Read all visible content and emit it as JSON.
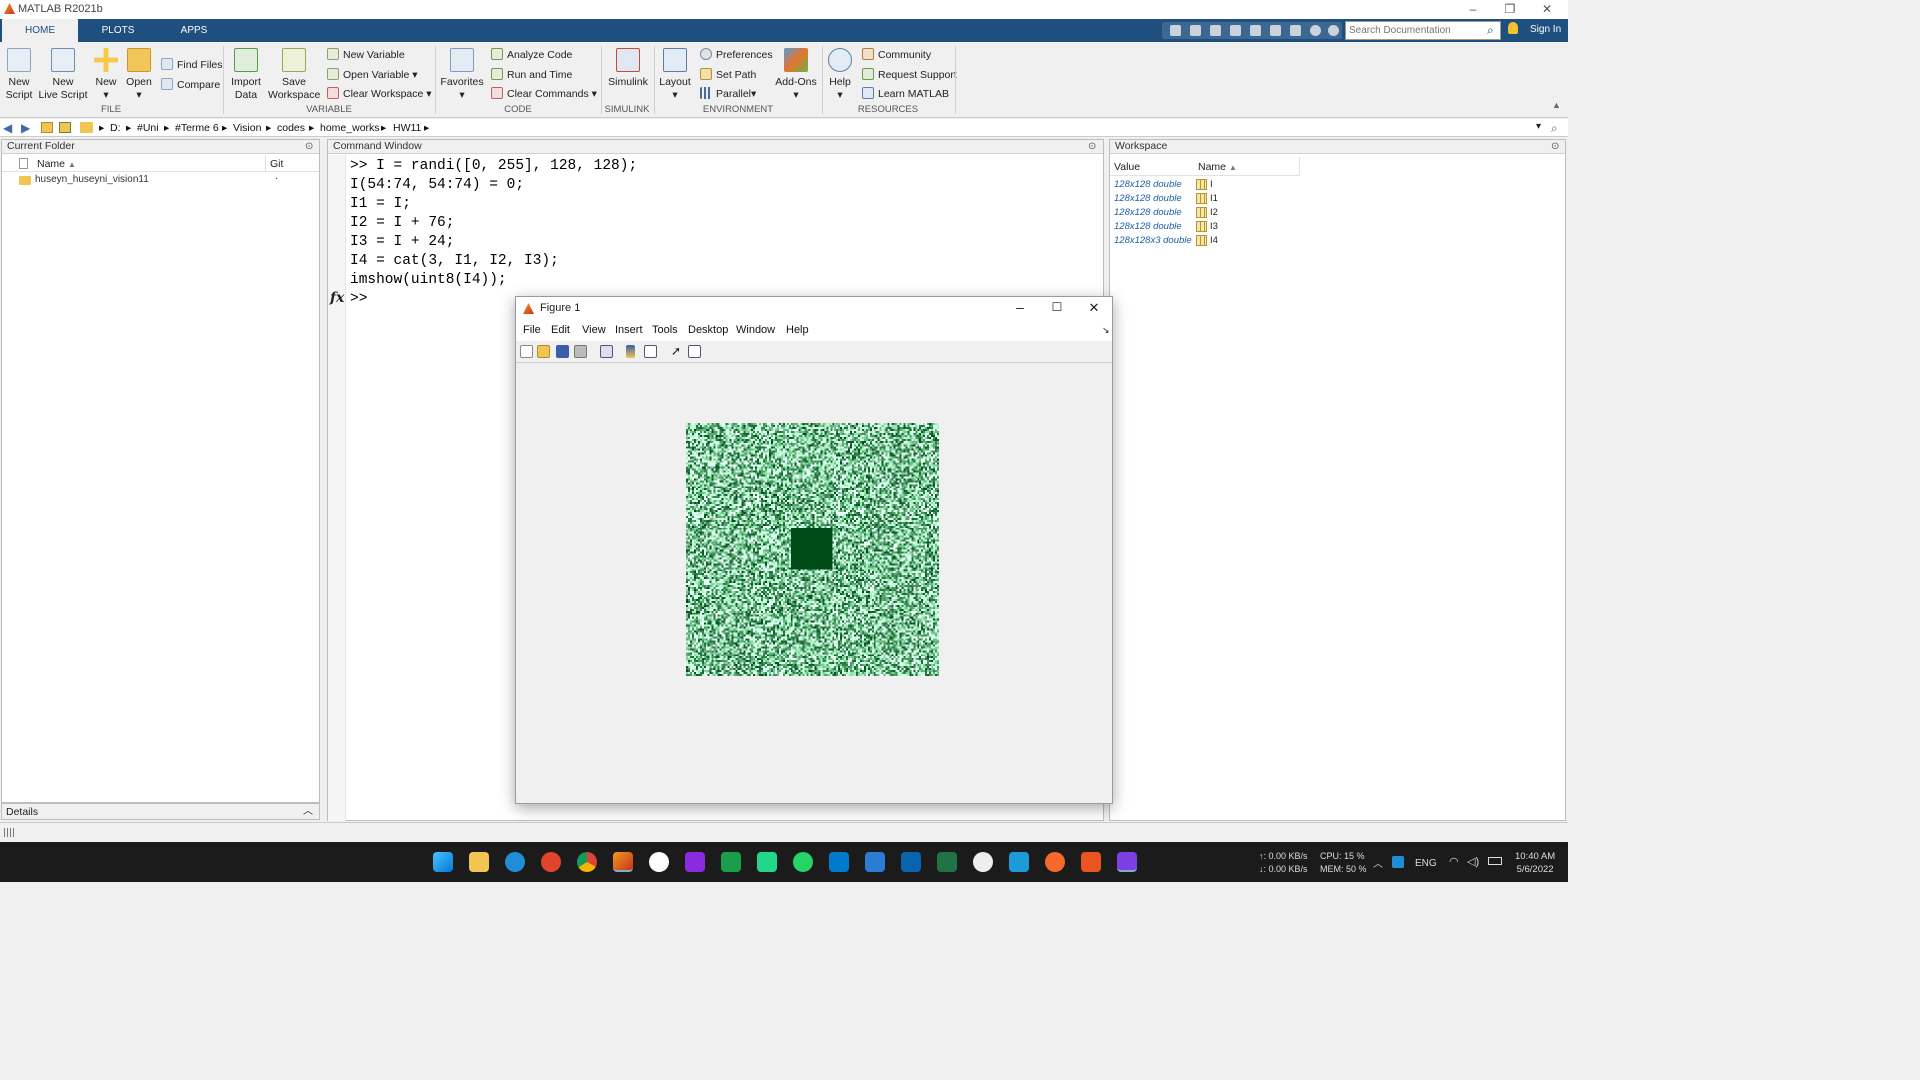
{
  "app": {
    "title": "MATLAB R2021b"
  },
  "tabs": [
    {
      "label": "HOME",
      "active": true
    },
    {
      "label": "PLOTS",
      "active": false
    },
    {
      "label": "APPS",
      "active": false
    }
  ],
  "search": {
    "placeholder": "Search Documentation"
  },
  "signin": "Sign In",
  "ribbon": {
    "file": {
      "new_script": [
        "New",
        "Script"
      ],
      "new_live_script": [
        "New",
        "Live Script"
      ],
      "new": "New",
      "open": "Open",
      "find_files": "Find Files",
      "compare": "Compare",
      "group": "FILE"
    },
    "variable": {
      "import_data": [
        "Import",
        "Data"
      ],
      "save_workspace": [
        "Save",
        "Workspace"
      ],
      "new_variable": "New Variable",
      "open_variable": "Open Variable",
      "clear_workspace": "Clear Workspace",
      "group": "VARIABLE"
    },
    "code": {
      "favorites": "Favorites",
      "analyze_code": "Analyze Code",
      "run_and_time": "Run and Time",
      "clear_commands": "Clear Commands",
      "group": "CODE"
    },
    "simulink": {
      "simulink": "Simulink",
      "group": "SIMULINK"
    },
    "environment": {
      "layout": "Layout",
      "preferences": "Preferences",
      "set_path": "Set Path",
      "parallel": "Parallel",
      "addons": "Add-Ons",
      "group": "ENVIRONMENT"
    },
    "resources": {
      "help": "Help",
      "community": "Community",
      "request_support": "Request Support",
      "learn_matlab": "Learn MATLAB",
      "group": "RESOURCES"
    }
  },
  "path": [
    "D:",
    "#Uni",
    "#Terme 6",
    "Vision",
    "codes",
    "home_works",
    "HW11"
  ],
  "current_folder": {
    "title": "Current Folder",
    "col_name": "Name",
    "col_git": "Git",
    "items": [
      {
        "name": "huseyn_huseyni_vision11",
        "git": "·"
      }
    ],
    "details": "Details"
  },
  "command_window": {
    "title": "Command Window",
    "lines": [
      ">> I = randi([0, 255], 128, 128);",
      "I(54:74, 54:74) = 0;",
      "I1 = I;",
      "I2 = I + 76;",
      "I3 = I + 24;",
      "I4 = cat(3, I1, I2, I3);",
      "imshow(uint8(I4));"
    ],
    "fx": "fx",
    "prompt": ">>"
  },
  "workspace": {
    "title": "Workspace",
    "col_value": "Value",
    "col_name": "Name",
    "rows": [
      {
        "value": "128x128 double",
        "name": "I"
      },
      {
        "value": "128x128 double",
        "name": "I1"
      },
      {
        "value": "128x128 double",
        "name": "I2"
      },
      {
        "value": "128x128 double",
        "name": "I3"
      },
      {
        "value": "128x128x3 double",
        "name": "I4"
      }
    ]
  },
  "figure": {
    "title": "Figure 1",
    "menus": [
      "File",
      "Edit",
      "View",
      "Insert",
      "Tools",
      "Desktop",
      "Window",
      "Help"
    ]
  },
  "taskbar": {
    "net_up": "↑: 0.00 KB/s",
    "net_down": "↓: 0.00 KB/s",
    "cpu": "CPU: 15 %",
    "mem": "MEM: 50 %",
    "lang": "ENG",
    "time": "10:40 AM",
    "date": "5/6/2022"
  },
  "colors": {
    "matlab_blue": "#1e4f7e",
    "workspace_value": "#1f5fa6",
    "image_dark_square": "#004d14"
  }
}
